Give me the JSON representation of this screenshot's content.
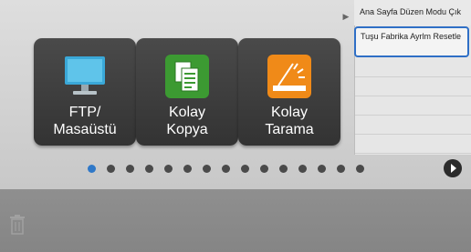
{
  "home": {
    "shortcuts": [
      {
        "label_line1": "FTP/",
        "label_line2": "Masaüstü",
        "icon": "monitor-icon"
      },
      {
        "label_line1": "Kolay",
        "label_line2": "Kopya",
        "icon": "copy-documents-icon"
      },
      {
        "label_line1": "Kolay",
        "label_line2": "Tarama",
        "icon": "scanner-icon"
      }
    ],
    "pagination": {
      "total_pages": 15,
      "current_page": 1
    }
  },
  "action_panel": {
    "items": [
      {
        "label": "Ana Sayfa Düzen Modu Çık"
      },
      {
        "label": "Tuşu Fabrika Ayrlm Resetle"
      }
    ]
  },
  "colors": {
    "accent": "#2f78c8",
    "tile_bg": "#3a3a3a",
    "copy_icon_bg": "#3c9a32",
    "scan_icon_bg": "#f08a18",
    "monitor_icon": "#3aa8d8"
  }
}
